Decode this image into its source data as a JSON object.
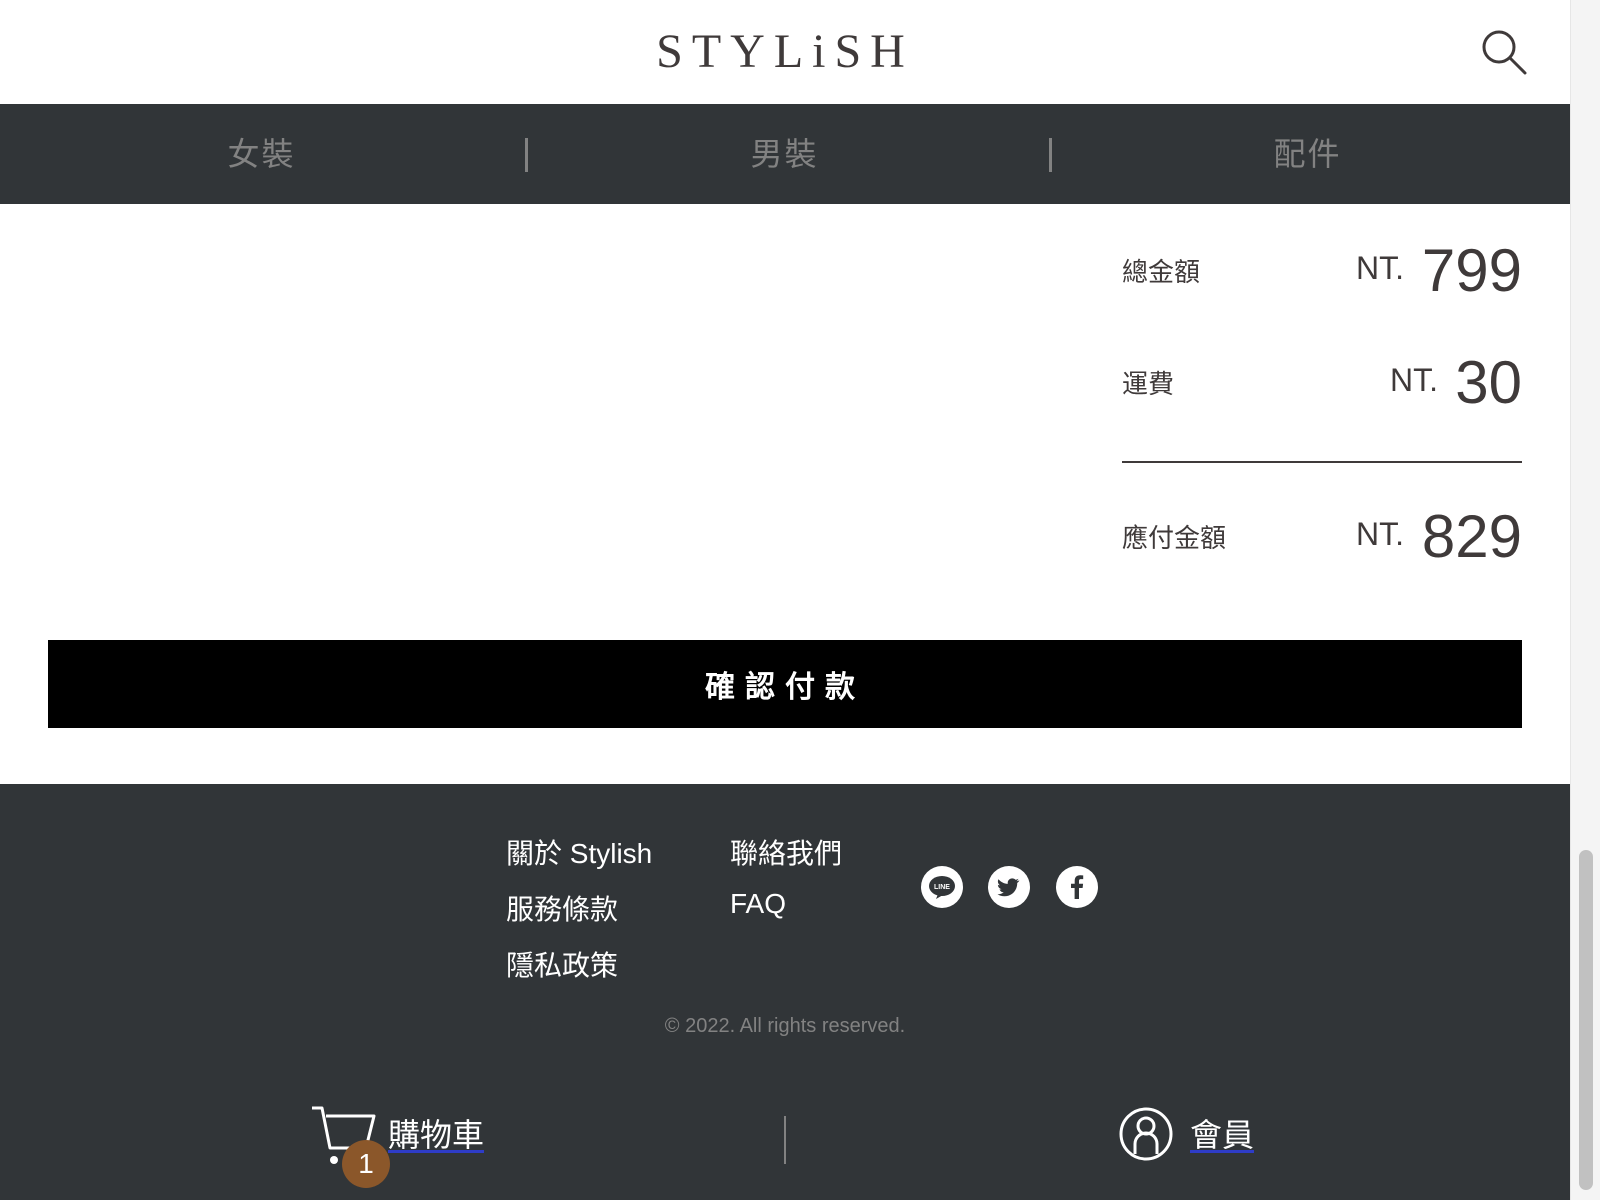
{
  "header": {
    "logo": "STYLiSH",
    "search_icon": "search-icon"
  },
  "nav": {
    "items": [
      "女裝",
      "男裝",
      "配件"
    ]
  },
  "summary": {
    "subtotal": {
      "label": "總金額",
      "currency": "NT.",
      "value": "799"
    },
    "shipping": {
      "label": "運費",
      "currency": "NT.",
      "value": "30"
    },
    "total": {
      "label": "應付金額",
      "currency": "NT.",
      "value": "829"
    }
  },
  "confirm_button": "確認付款",
  "footer": {
    "links_col1": [
      "關於 Stylish",
      "服務條款",
      "隱私政策"
    ],
    "links_col2": [
      "聯絡我們",
      "FAQ"
    ],
    "social_icons": [
      "line-icon",
      "twitter-icon",
      "facebook-icon"
    ],
    "line_icon_text": "LINE",
    "copyright": "© 2022. All rights reserved."
  },
  "bottom_bar": {
    "cart_label": "購物車",
    "cart_count": "1",
    "member_label": "會員"
  },
  "colors": {
    "nav_bg": "#313538",
    "badge": "#8b572a",
    "text_dark": "#3f3a3a",
    "muted": "#828282"
  }
}
